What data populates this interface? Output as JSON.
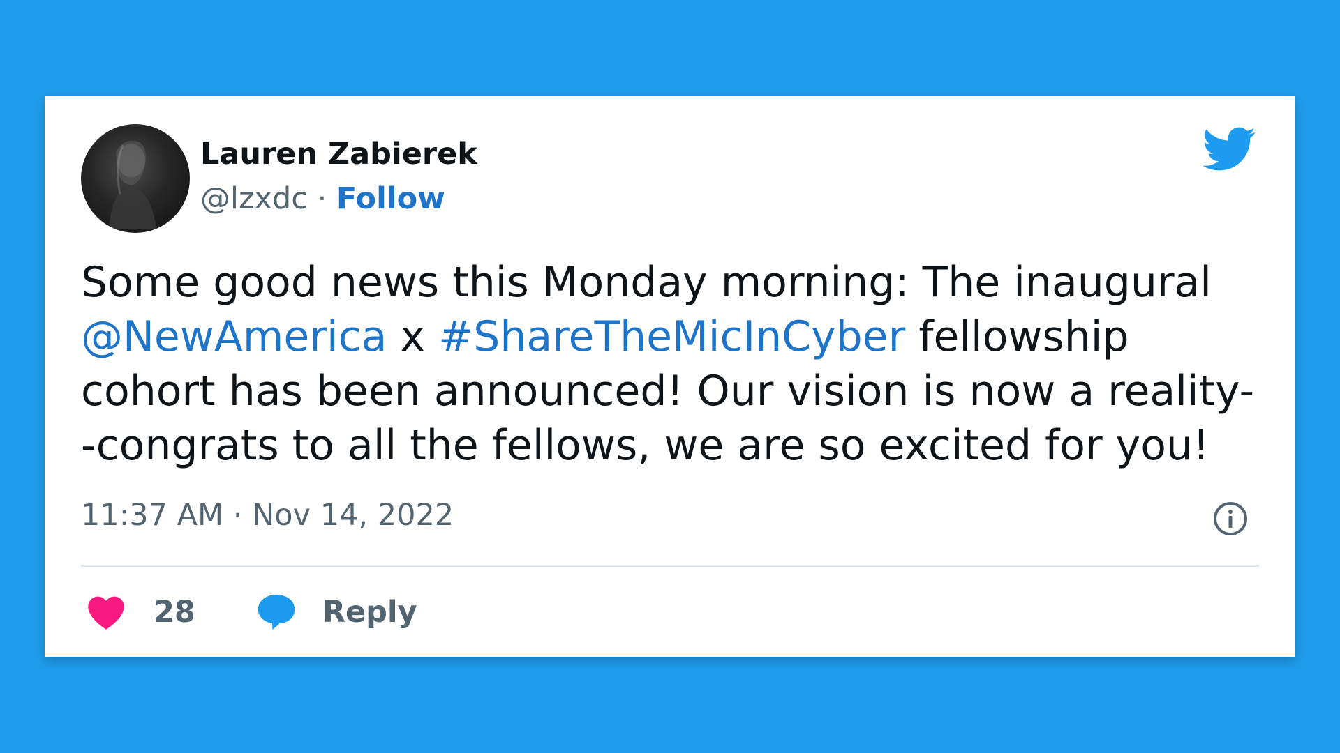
{
  "author": {
    "name": "Lauren Zabierek",
    "handle": "@lzxdc",
    "separator": "·",
    "follow_label": "Follow",
    "avatar_icon": "profile-photo-avatar"
  },
  "tweet": {
    "line1": "Some good news this Monday morning: The inaugural",
    "line2_mention": "@NewAmerica",
    "line2_x": " x ",
    "line2_hashtag": "#ShareTheMicInCyber",
    "line2_rest": " fellowship",
    "line3": "cohort has been announced! Our vision is now a reality-",
    "line4": "-congrats to all the fellows, we are so excited for you!"
  },
  "meta": {
    "time": "11:37 AM",
    "separator": "·",
    "date": "Nov 14, 2022"
  },
  "actions": {
    "like_count": "28",
    "reply_label": "Reply"
  },
  "icons": {
    "brand": "twitter-bird-icon",
    "info": "info-icon",
    "like": "heart-icon",
    "reply": "speech-bubble-icon"
  },
  "colors": {
    "background": "#1f9ded",
    "card": "#ffffff",
    "link": "#1d74c9",
    "heart": "#f91880",
    "reply_bubble": "#1d9bf0",
    "twitter_blue": "#1d9bf0",
    "muted": "#536471"
  }
}
